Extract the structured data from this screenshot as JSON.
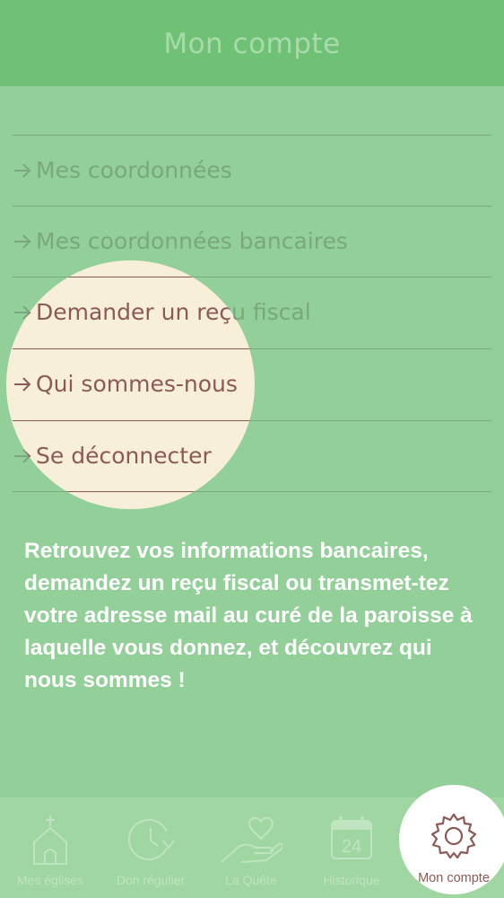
{
  "header": {
    "title": "Mon compte"
  },
  "menu": {
    "items": [
      {
        "label": "Mes coordonnées"
      },
      {
        "label": "Mes coordonnées bancaires"
      },
      {
        "label": "Demander un reçu fiscal"
      },
      {
        "label": "Qui sommes-nous"
      },
      {
        "label": "Se déconnecter"
      }
    ]
  },
  "description": "Retrouvez vos informations bancaires, demandez un reçu fiscal ou transmet-tez votre adresse mail au curé de la paroisse à laquelle vous donnez, et découvrez qui nous sommes !",
  "tabbar": {
    "tabs": [
      {
        "label": "Mes églises",
        "icon": "church-icon"
      },
      {
        "label": "Don régulier",
        "icon": "clock-refresh-icon"
      },
      {
        "label": "La Quête",
        "icon": "heart-hand-icon"
      },
      {
        "label": "Historique",
        "icon": "calendar-icon",
        "day": "24"
      },
      {
        "label": "Mon compte",
        "icon": "gear-icon",
        "active": true
      }
    ]
  },
  "colors": {
    "background": "#93cf98",
    "header": "#6fc175",
    "lens": "#f8efda",
    "accent_brown": "#8c5a55",
    "text_white": "#ffffff"
  }
}
